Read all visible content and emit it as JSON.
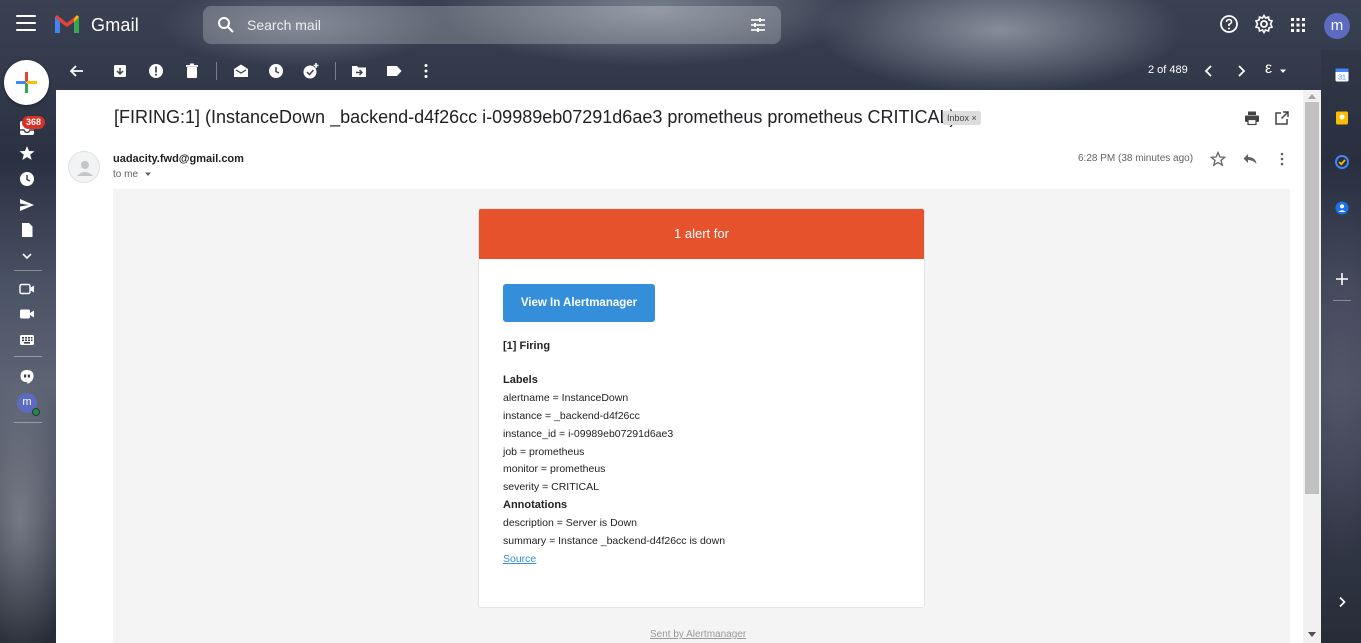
{
  "app": {
    "name": "Gmail",
    "brand_colors": {
      "red": "#ea4335",
      "blue": "#4285f4",
      "yellow": "#fbbc04",
      "green": "#34a853"
    }
  },
  "search": {
    "placeholder": "Search mail"
  },
  "user": {
    "initial": "m",
    "avatar_color": "#5c6bc0"
  },
  "sidebar": {
    "inbox_badge": "368",
    "icons": [
      "compose-icon",
      "inbox-icon",
      "star-icon",
      "clock-icon",
      "send-icon",
      "file-icon",
      "chevron-down-icon",
      "meet-icon",
      "video-icon",
      "keyboard-icon",
      "hangouts-icon"
    ]
  },
  "toolbar": {
    "icons": [
      "back-arrow-icon",
      "archive-icon",
      "report-spam-icon",
      "delete-icon",
      "mark-unread-icon",
      "snooze-icon",
      "add-task-icon",
      "move-to-icon",
      "label-icon",
      "more-vert-icon"
    ],
    "pager": "2 of 489",
    "input_tool": "ε"
  },
  "message": {
    "subject": "[FIRING:1] (InstanceDown _backend-d4f26cc i-09989eb07291d6ae3 prometheus prometheus CRITICAL)",
    "label_chip": "Inbox",
    "label_chip_close": "×",
    "sender": "uadacity.fwd@gmail.com",
    "recipient": "to me",
    "time": "6:28 PM (38 minutes ago)"
  },
  "email": {
    "header": "1 alert for",
    "header_color": "#e6522c",
    "button_label": "View In Alertmanager",
    "button_color": "#348eda",
    "firing": "[1] Firing",
    "labels_heading": "Labels",
    "labels": [
      "alertname = InstanceDown",
      "instance = _backend-d4f26cc",
      "instance_id = i-09989eb07291d6ae3",
      "job = prometheus",
      "monitor = prometheus",
      "severity = CRITICAL"
    ],
    "annotations_heading": "Annotations",
    "annotations": [
      "description = Server is Down",
      "summary = Instance _backend-d4f26cc is down"
    ],
    "source_link": "Source",
    "footer_link": "Sent by Alertmanager"
  },
  "side_panel": {
    "icons": [
      "calendar-icon",
      "keep-icon",
      "tasks-icon",
      "contacts-icon",
      "add-icon",
      "expand-panel-icon"
    ]
  }
}
